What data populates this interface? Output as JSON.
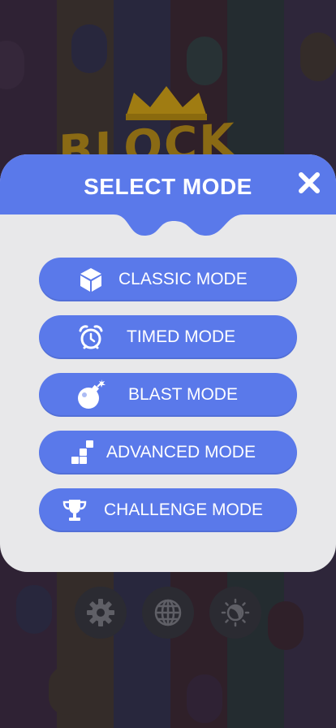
{
  "logo": {
    "text": "BLOCK"
  },
  "modal": {
    "title": "SELECT MODE",
    "close_icon": "close-icon"
  },
  "modes": [
    {
      "label": "CLASSIC MODE",
      "icon": "cube-icon"
    },
    {
      "label": "TIMED MODE",
      "icon": "alarm-clock-icon"
    },
    {
      "label": "BLAST MODE",
      "icon": "bomb-icon"
    },
    {
      "label": "ADVANCED MODE",
      "icon": "blocks-icon"
    },
    {
      "label": "CHALLENGE MODE",
      "icon": "trophy-icon"
    }
  ],
  "bottom_buttons": [
    {
      "icon": "gear-icon"
    },
    {
      "icon": "globe-icon"
    },
    {
      "icon": "theme-icon"
    }
  ],
  "colors": {
    "accent": "#5a79ea",
    "modal_bg": "#e8e8ea",
    "button_text": "#ffffff"
  }
}
